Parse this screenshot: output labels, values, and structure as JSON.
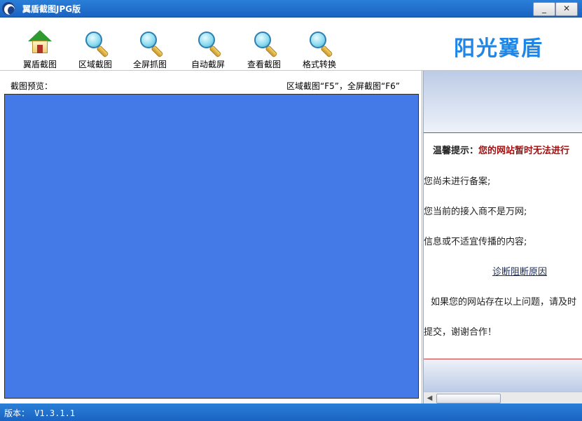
{
  "window": {
    "title": "翼盾截图JPG版",
    "minimize_glyph": "_",
    "close_glyph": "✕"
  },
  "toolbar": {
    "items": [
      {
        "label": "翼盾截图",
        "icon": "home-icon"
      },
      {
        "label": "区域截图",
        "icon": "magnifier-icon"
      },
      {
        "label": "全屏抓图",
        "icon": "magnifier-icon"
      },
      {
        "label": "自动截屏",
        "icon": "magnifier-icon"
      },
      {
        "label": "查看截图",
        "icon": "magnifier-icon"
      },
      {
        "label": "格式转换",
        "icon": "magnifier-icon"
      }
    ],
    "brand": "阳光翼盾"
  },
  "preview": {
    "label": "截图预览：",
    "hotkeys": "区域截图“F5”，全屏截图“F6”",
    "background_color": "#4479e8"
  },
  "webview": {
    "tip_label": "温馨提示：",
    "tip_message": "您的网站暂时无法进行",
    "lines": [
      "您尚未进行备案;",
      "您当前的接入商不是万网;",
      "信息或不适宜传播的内容;"
    ],
    "diagnose_link": "诊断阻断原因",
    "notice": "如果您的网站存在以上问题，请及时",
    "thanks": "提交，谢谢合作！"
  },
  "status": {
    "version": "版本： V1.3.1.1"
  },
  "colors": {
    "titlebar": "#1e6fcc",
    "brand": "#1e86e8",
    "tip_message": "#a01010"
  }
}
